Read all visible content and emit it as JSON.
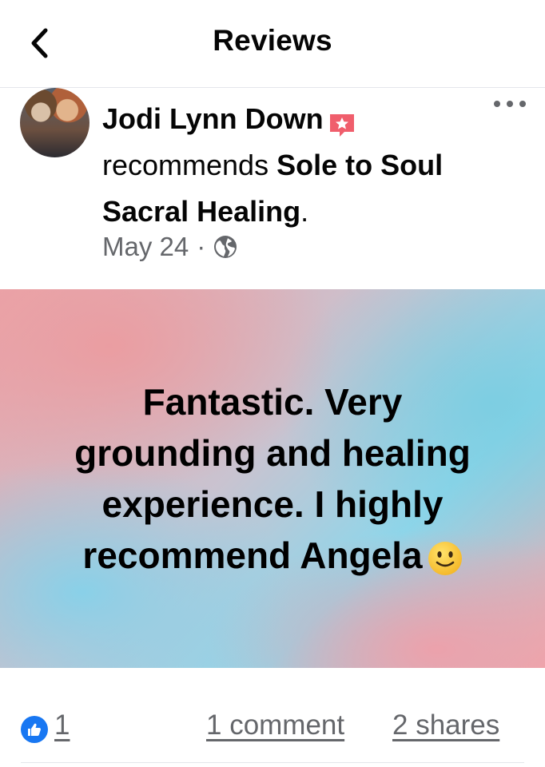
{
  "header": {
    "title": "Reviews",
    "back_icon": "chevron-left-icon"
  },
  "post": {
    "author": "Jodi Lynn Down",
    "badge_icon": "recommendation-star-icon",
    "action_text": "recommends",
    "page_name": "Sole to Soul Sacral Healing",
    "page_name_suffix": ".",
    "date": "May 24",
    "separator": "·",
    "audience_icon": "globe-icon",
    "more_icon": "more-dots-icon"
  },
  "review": {
    "text": "Fantastic. Very grounding and healing experience. I highly recommend Angela",
    "emoji_icon": "slightly-smiling-face-icon",
    "colors": {
      "pink": "#eba4a9",
      "cyan": "#8fd6ea"
    }
  },
  "footer": {
    "like_icon": "thumbs-up-icon",
    "like_count": "1",
    "comments": "1 comment",
    "shares": "2 shares",
    "accent_color": "#1877f2"
  }
}
